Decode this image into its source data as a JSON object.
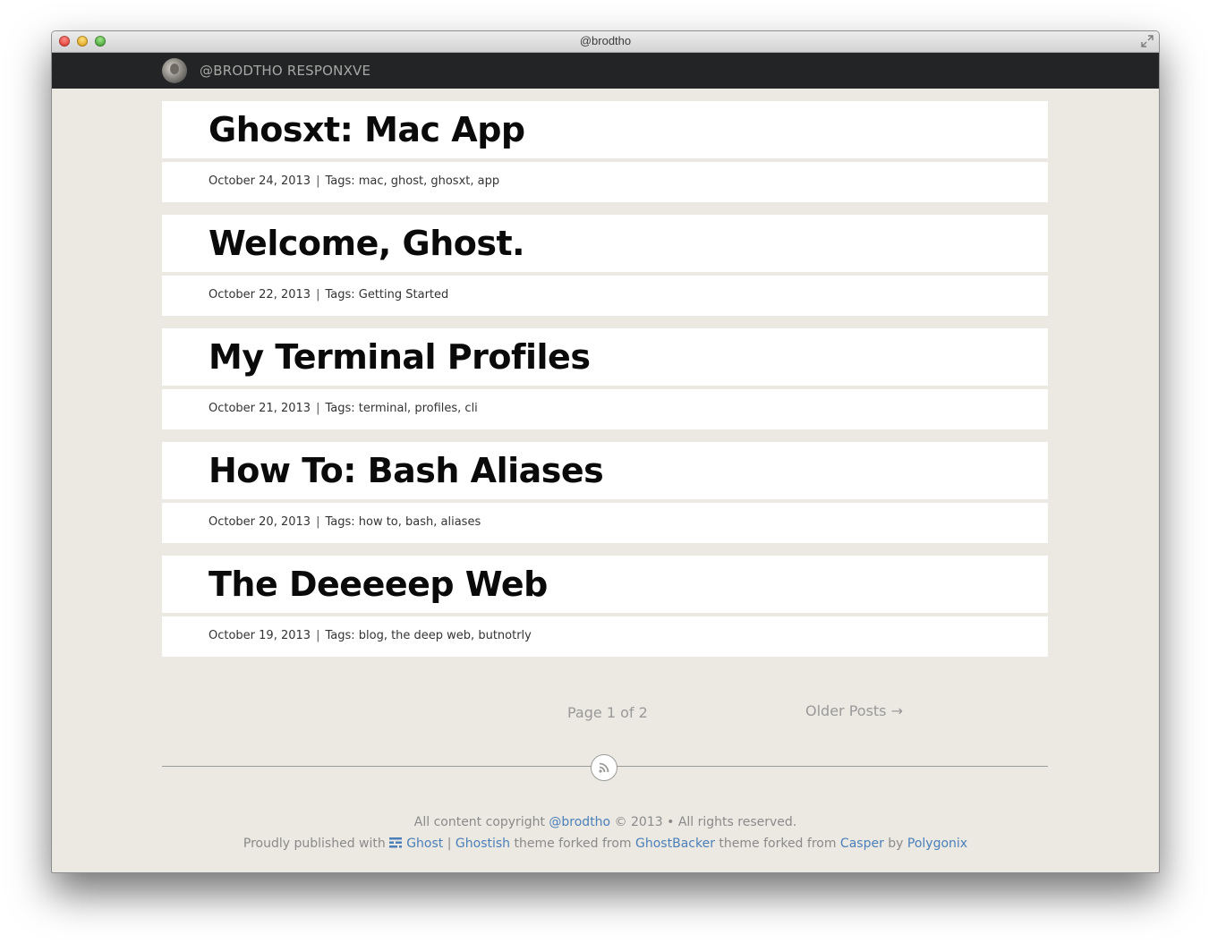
{
  "window": {
    "title": "@brodtho"
  },
  "navbar": {
    "blog_title": "@BRODTHO RESPONXVE"
  },
  "posts": [
    {
      "title": "Ghosxt: Mac App",
      "date": "October 24, 2013",
      "separator": "|",
      "tags": "Tags: mac, ghost, ghosxt, app"
    },
    {
      "title": "Welcome, Ghost.",
      "date": "October 22, 2013",
      "separator": "|",
      "tags": "Tags: Getting Started"
    },
    {
      "title": "My Terminal Profiles",
      "date": "October 21, 2013",
      "separator": "|",
      "tags": "Tags: terminal, profiles, cli"
    },
    {
      "title": "How To: Bash Aliases",
      "date": "October 20, 2013",
      "separator": "|",
      "tags": "Tags: how to, bash, aliases"
    },
    {
      "title": "The Deeeeep Web",
      "date": "October 19, 2013",
      "separator": "|",
      "tags": "Tags: blog, the deep web, butnotrly"
    }
  ],
  "pagination": {
    "page_text": "Page 1 of 2",
    "older_label": "Older Posts →"
  },
  "footer": {
    "line1_prefix": "All content copyright ",
    "line1_link": "@brodtho",
    "line1_suffix": " © 2013 • All rights reserved.",
    "line2_prefix": "Proudly published with ",
    "ghost_link": "Ghost",
    "pipe": " | ",
    "ghostish_link": "Ghostish",
    "forked_text_1": " theme forked from ",
    "ghostbacker_link": "GhostBacker",
    "forked_text_2": " theme forked from ",
    "casper_link": "Casper",
    "by_text": " by ",
    "polygonix_link": "Polygonix"
  },
  "colors": {
    "nav_background": "#232425",
    "page_background": "#ebe9e2",
    "link": "#4a7fba"
  },
  "icons": {
    "rss": "rss-icon",
    "ghost": "ghost-logo-icon",
    "fullscreen": "fullscreen-icon",
    "older_arrow": "right-arrow"
  }
}
